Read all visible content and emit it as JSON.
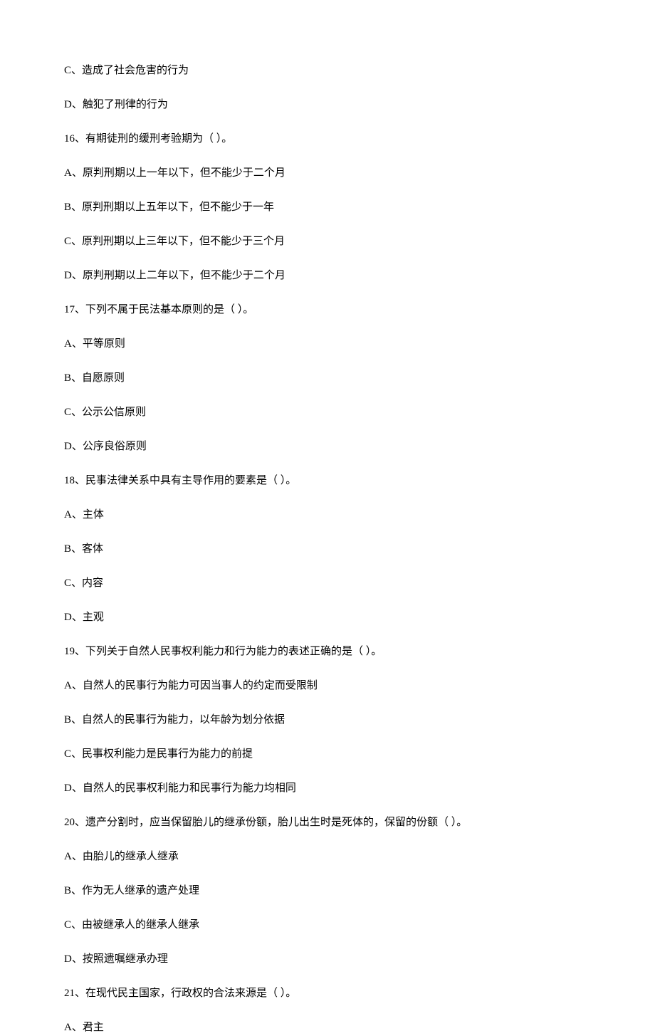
{
  "lines": [
    "C、造成了社会危害的行为",
    "D、触犯了刑律的行为",
    "16、有期徒刑的缓刑考验期为（  ）。",
    "A、原判刑期以上一年以下，但不能少于二个月",
    "B、原判刑期以上五年以下，但不能少于一年",
    "C、原判刑期以上三年以下，但不能少于三个月",
    "D、原判刑期以上二年以下，但不能少于二个月",
    "17、下列不属于民法基本原则的是（  ）。",
    "A、平等原则",
    "B、自愿原则",
    "C、公示公信原则",
    "D、公序良俗原则",
    "18、民事法律关系中具有主导作用的要素是（  ）。",
    "A、主体",
    "B、客体",
    "C、内容",
    "D、主观",
    "19、下列关于自然人民事权利能力和行为能力的表述正确的是（  ）。",
    "A、自然人的民事行为能力可因当事人的约定而受限制",
    "B、自然人的民事行为能力，以年龄为划分依据",
    "C、民事权利能力是民事行为能力的前提",
    "D、自然人的民事权利能力和民事行为能力均相同",
    "20、遗产分割时，应当保留胎儿的继承份额，胎儿出生时是死体的，保留的份额（  ）。",
    "A、由胎儿的继承人继承",
    "B、作为无人继承的遗产处理",
    "C、由被继承人的继承人继承",
    "D、按照遗嘱继承办理",
    "21、在现代民主国家，行政权的合法来源是（  ）。",
    "A、君主"
  ]
}
